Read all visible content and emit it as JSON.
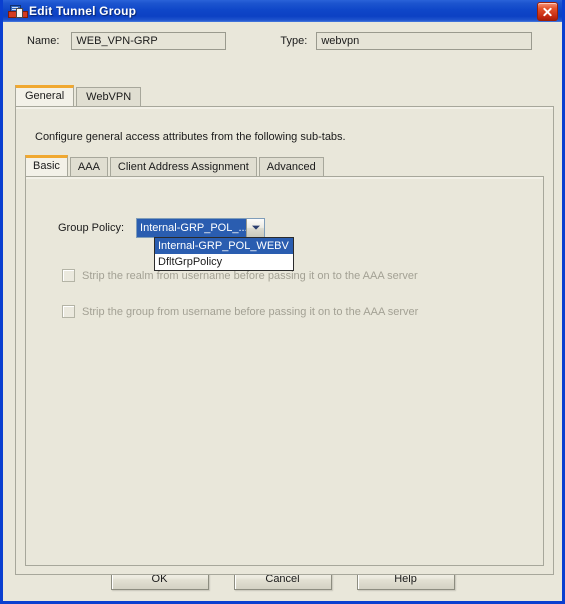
{
  "window": {
    "title": "Edit Tunnel Group",
    "icon": "tunnel-group-icon",
    "close_label": "×"
  },
  "fields": {
    "name_label": "Name:",
    "name_value": "WEB_VPN-GRP",
    "type_label": "Type:",
    "type_value": "webvpn"
  },
  "tabs": [
    {
      "label": "General",
      "active": true
    },
    {
      "label": "WebVPN",
      "active": false
    }
  ],
  "panel": {
    "description": "Configure general access attributes from the following sub-tabs."
  },
  "subtabs": [
    {
      "label": "Basic",
      "active": true
    },
    {
      "label": "AAA",
      "active": false
    },
    {
      "label": "Client Address Assignment",
      "active": false
    },
    {
      "label": "Advanced",
      "active": false
    }
  ],
  "group_policy": {
    "label": "Group Policy:",
    "selected_display": "Internal-GRP_POL_...",
    "dropdown_open": true,
    "options": [
      {
        "label": "Internal-GRP_POL_WEBV",
        "selected": true
      },
      {
        "label": "DfltGrpPolicy",
        "selected": false
      }
    ]
  },
  "checkboxes": [
    {
      "label": "Strip the realm from username before passing it on to the AAA server",
      "checked": false,
      "disabled": true
    },
    {
      "label": "Strip the group from username before passing it on to the AAA server",
      "checked": false,
      "disabled": true
    }
  ],
  "buttons": {
    "ok": "OK",
    "cancel": "Cancel",
    "help": "Help"
  },
  "colors": {
    "titlebar_blue": "#0f46c8",
    "window_border": "#0a3fd0",
    "tab_accent": "#f0a830",
    "selection_blue": "#2a5db0",
    "panel_bg": "#e9e7da",
    "close_red": "#c62b12"
  }
}
